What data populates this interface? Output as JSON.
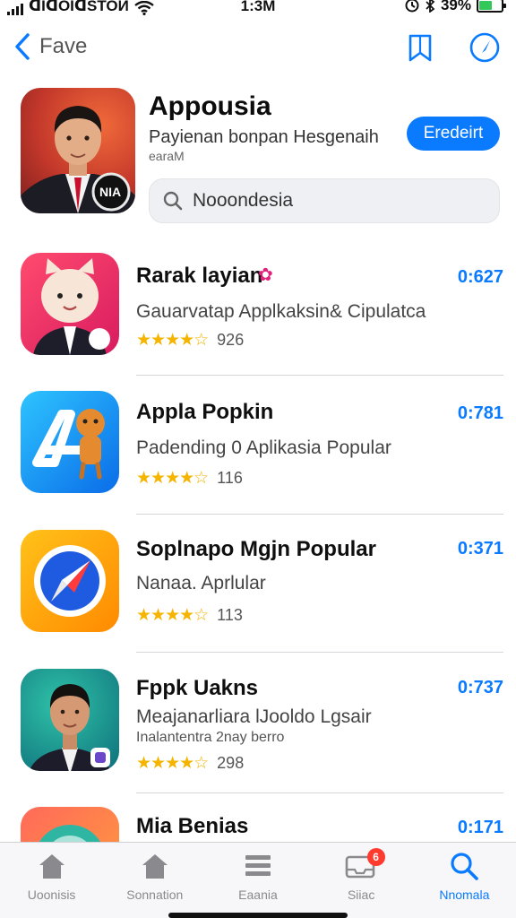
{
  "status_bar": {
    "carrier": "ᗡIᗡOIᗡSTOИ",
    "time": "1:3M",
    "battery_pct": "39%",
    "battery_level": 0.6
  },
  "nav": {
    "back_label": "Fave",
    "colors": {
      "accent": "#0a7aff"
    }
  },
  "featured": {
    "title": "Appousia",
    "subtitle": "Payienan bonpan Hesgenaih",
    "subtitle2": "earaM",
    "get_label": "Eredeirt",
    "badge_text": "NIA",
    "search": {
      "value": "Nooondesia",
      "placeholder": "Nooondesia"
    }
  },
  "apps": [
    {
      "name": "Rarak layian",
      "desc": "Gauarvatap  Applkaksin& Cipulatca",
      "desc2": "",
      "stars": "★★★★☆",
      "count": "926",
      "price": "0:627"
    },
    {
      "name": "Appla Popkin",
      "desc": "Padending 0  Aplikasia Popular",
      "desc2": "",
      "stars": "★★★★☆",
      "count": "116",
      "price": "0:781"
    },
    {
      "name": "Soplnapo Mgjn Popular",
      "desc": "Nanaa. Aprlular",
      "desc2": "",
      "stars": "★★★★☆",
      "count": "113",
      "price": "0:371"
    },
    {
      "name": "Fppk Uakns",
      "desc": "Meajanarliara lJooldo Lgsair",
      "desc2": "Inalantentra 2nay berro",
      "stars": "★★★★☆",
      "count": "298",
      "price": "0:737"
    },
    {
      "name": "Mia Benias",
      "desc": "",
      "desc2": "",
      "stars": "",
      "count": "",
      "price": "0:171"
    }
  ],
  "tabs": [
    {
      "label": "Uoonisis",
      "icon": "house-icon"
    },
    {
      "label": "Sonnation",
      "icon": "house-icon"
    },
    {
      "label": "Eaania",
      "icon": "list-icon"
    },
    {
      "label": "Siiac",
      "icon": "inbox-icon",
      "badge": "6"
    },
    {
      "label": "Nnomala",
      "icon": "search-icon"
    }
  ]
}
